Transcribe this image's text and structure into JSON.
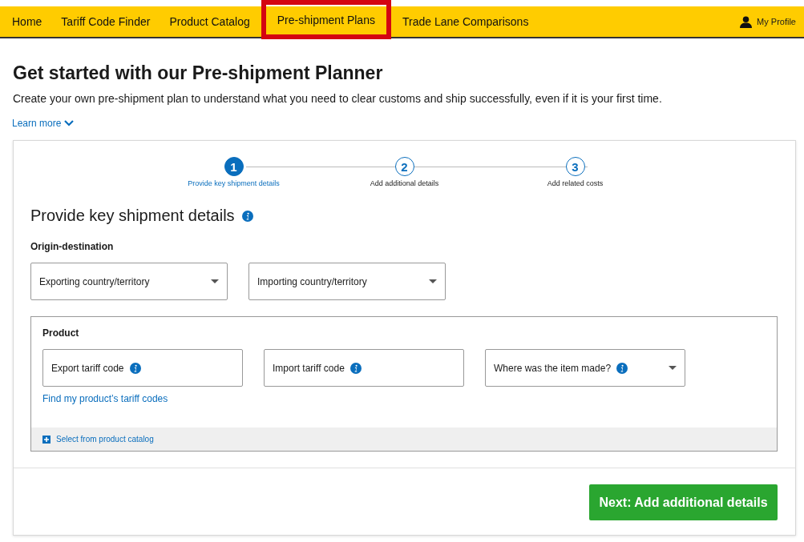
{
  "nav": {
    "tabs": [
      {
        "label": "Home",
        "selected": false
      },
      {
        "label": "Tariff Code Finder",
        "selected": false
      },
      {
        "label": "Product Catalog",
        "selected": false
      },
      {
        "label": "Pre-shipment Plans",
        "selected": true
      },
      {
        "label": "Trade Lane Comparisons",
        "selected": false
      }
    ],
    "profile": "My Profile"
  },
  "title": "Get started with our Pre-shipment Planner",
  "subtitle": "Create your own pre-shipment plan to understand what you need to clear customs and ship successfully, even if it is your first time.",
  "learn_more": "Learn more",
  "steps": [
    {
      "number": "1",
      "label": "Provide key shipment details",
      "selected": true
    },
    {
      "number": "2",
      "label": "Add additional details",
      "selected": false
    },
    {
      "number": "3",
      "label": "Add related costs",
      "selected": false
    }
  ],
  "section_title": "Provide key shipment details",
  "origin_label": "Origin-destination",
  "origin_fields": [
    {
      "kind": "dropdown",
      "label": "Exporting country/territory",
      "info": false
    },
    {
      "kind": "dropdown",
      "label": "Importing country/territory",
      "info": false
    }
  ],
  "product": {
    "label": "Product",
    "fields": [
      {
        "kind": "text",
        "label": "Export tariff code",
        "info": true
      },
      {
        "kind": "text",
        "label": "Import tariff code",
        "info": true
      },
      {
        "kind": "dropdown",
        "label": "Where was the item made?",
        "info": true
      }
    ],
    "link": "Find my product’s tariff codes",
    "catalog": "Select from product catalog"
  },
  "next_button": "Next: Add additional details"
}
